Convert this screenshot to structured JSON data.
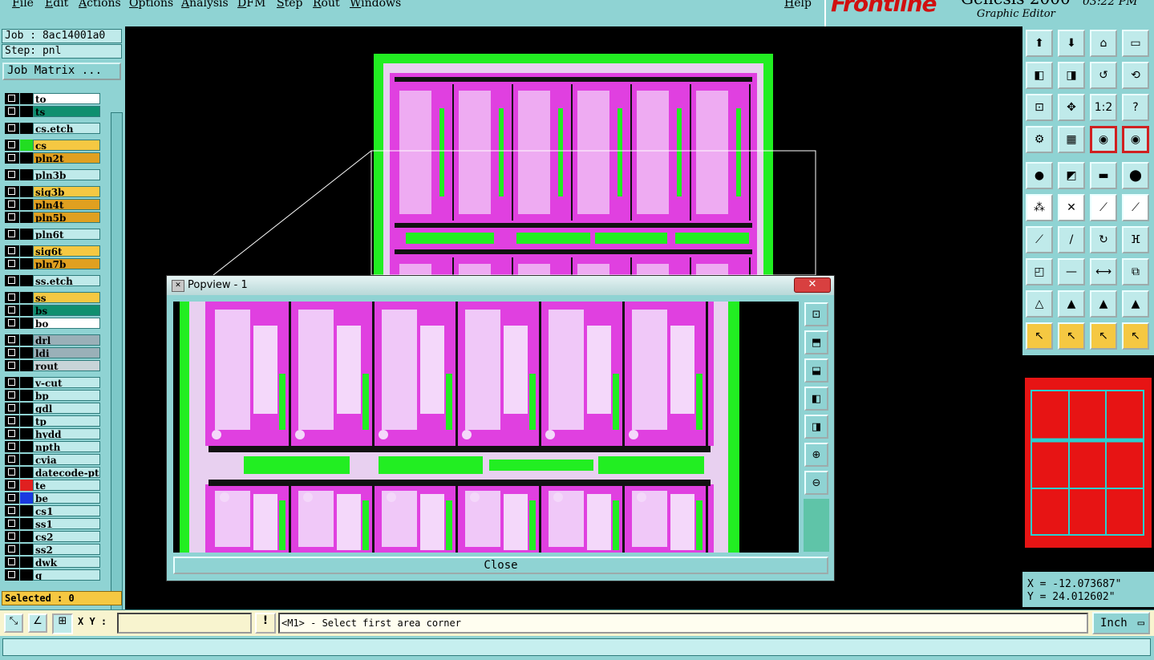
{
  "menu": {
    "items": [
      "File",
      "Edit",
      "Actions",
      "Options",
      "Analysis",
      "DFM",
      "Step",
      "Rout",
      "Windows"
    ],
    "help": "Help"
  },
  "brand": {
    "logo": "Frontline",
    "product": "Genesis 2000",
    "subtitle": "Graphic Editor",
    "clock": "03:22 PM"
  },
  "job": {
    "job_label": "Job : 8ac14001a0",
    "step_label": "Step: pnl",
    "job_matrix_button": "Job Matrix ..."
  },
  "layers": [
    {
      "name": "to",
      "color": "#ffffff",
      "swatch": "#000000"
    },
    {
      "name": "ts",
      "color": "#0f8f6f",
      "swatch": "#000000"
    },
    {
      "name": "cs.etch",
      "color": "#bfeaea",
      "swatch": "#000000"
    },
    {
      "name": "cs",
      "color": "#f5c842",
      "swatch": "#22dd22"
    },
    {
      "name": "pln2t",
      "color": "#e0a020",
      "swatch": "#000000"
    },
    {
      "name": "pln3b",
      "color": "#bfeaea",
      "swatch": "#000000"
    },
    {
      "name": "sig3b",
      "color": "#f5c842",
      "swatch": "#000000"
    },
    {
      "name": "pln4t",
      "color": "#e0a020",
      "swatch": "#000000"
    },
    {
      "name": "pln5b",
      "color": "#e0a020",
      "swatch": "#000000"
    },
    {
      "name": "pln6t",
      "color": "#bfeaea",
      "swatch": "#000000"
    },
    {
      "name": "sig6t",
      "color": "#f5c842",
      "swatch": "#000000"
    },
    {
      "name": "pln7b",
      "color": "#e0a020",
      "swatch": "#000000"
    },
    {
      "name": "ss.etch",
      "color": "#bfeaea",
      "swatch": "#000000"
    },
    {
      "name": "ss",
      "color": "#f5c842",
      "swatch": "#000000"
    },
    {
      "name": "bs",
      "color": "#0f8f6f",
      "swatch": "#000000"
    },
    {
      "name": "bo",
      "color": "#ffffff",
      "swatch": "#000000"
    },
    {
      "name": "drl",
      "color": "#9ab0b8",
      "swatch": "#000000"
    },
    {
      "name": "ldi",
      "color": "#9ab0b8",
      "swatch": "#000000"
    },
    {
      "name": "rout",
      "color": "#c8d4d8",
      "swatch": "#000000"
    },
    {
      "name": "v-cut",
      "color": "#bfeaea",
      "swatch": "#000000"
    },
    {
      "name": "bp",
      "color": "#bfeaea",
      "swatch": "#000000"
    },
    {
      "name": "gdl",
      "color": "#bfeaea",
      "swatch": "#000000"
    },
    {
      "name": "tp",
      "color": "#bfeaea",
      "swatch": "#000000"
    },
    {
      "name": "hydd",
      "color": "#bfeaea",
      "swatch": "#000000"
    },
    {
      "name": "npth",
      "color": "#bfeaea",
      "swatch": "#000000"
    },
    {
      "name": "cvia",
      "color": "#bfeaea",
      "swatch": "#000000"
    },
    {
      "name": "datecode-ptc",
      "color": "#bfeaea",
      "swatch": "#000000"
    },
    {
      "name": "te",
      "color": "#bfeaea",
      "swatch": "#e02020"
    },
    {
      "name": "be",
      "color": "#bfeaea",
      "swatch": "#1a3adf"
    },
    {
      "name": "cs1",
      "color": "#bfeaea",
      "swatch": "#000000"
    },
    {
      "name": "ss1",
      "color": "#bfeaea",
      "swatch": "#000000"
    },
    {
      "name": "cs2",
      "color": "#bfeaea",
      "swatch": "#000000"
    },
    {
      "name": "ss2",
      "color": "#bfeaea",
      "swatch": "#000000"
    },
    {
      "name": "dwk",
      "color": "#bfeaea",
      "swatch": "#000000"
    },
    {
      "name": "q",
      "color": "#bfeaea",
      "swatch": "#000000"
    }
  ],
  "selected": "Selected : 0",
  "coords": {
    "x": "X = -12.073687\"",
    "y": "Y = 24.012602\""
  },
  "bottom": {
    "xy_label": "X Y :",
    "xy_value": "",
    "warn_icon_text": "!",
    "prompt": "<M1> - Select first area corner",
    "units": "Inch"
  },
  "popview": {
    "title": "Popview - 1",
    "close_label": "Close"
  },
  "colors": {
    "ui_teal": "#8fd3d3",
    "board_magenta": "#e040e0",
    "board_green": "#22ee22",
    "overview_red": "#e71414"
  }
}
